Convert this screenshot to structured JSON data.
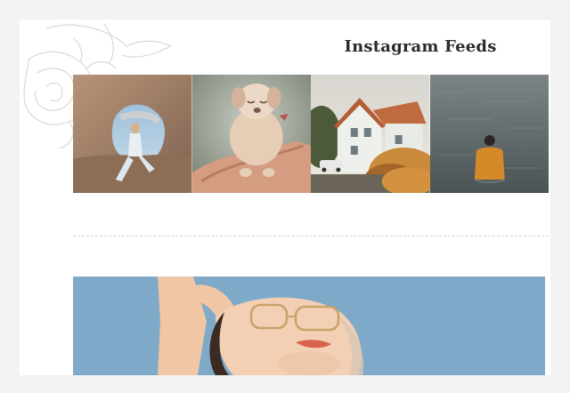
{
  "section": {
    "title": "Instagram Feeds"
  },
  "feed": {
    "items": [
      {
        "name": "rock-arch-photo"
      },
      {
        "name": "puppy-in-hand-photo"
      },
      {
        "name": "house-at-sunset-photo"
      },
      {
        "name": "person-in-water-photo"
      }
    ]
  },
  "hero": {
    "name": "sunbathing-woman-photo"
  },
  "colors": {
    "background": "#f2f2f2",
    "card": "#ffffff",
    "title": "#2b2b2b",
    "divider": "#cfcfcf",
    "sky": "#7fa9c9"
  }
}
